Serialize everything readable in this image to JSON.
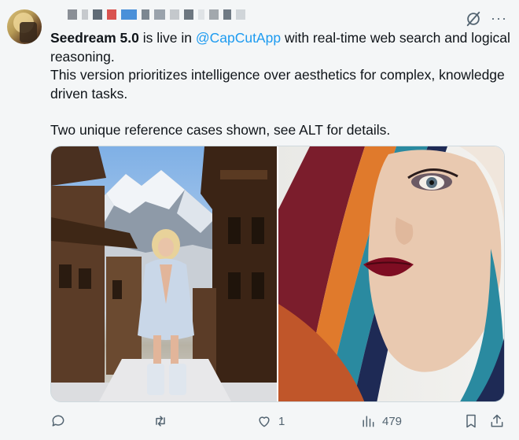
{
  "author": {
    "avatar_icon": "avatar-icon",
    "name_pixels": [
      "#8a8f96",
      "#c6c9cd",
      "#5f6b76",
      "#d9534f",
      "#4a90d9",
      "#7c8791",
      "#9aa3ac",
      "#c4c8cc",
      "#6d7780",
      "#dfe3e6",
      "#a2a8ad",
      "#6f7a84",
      "#d0d5d9"
    ]
  },
  "header_icons": {
    "grok": "grok-icon",
    "more": "more-icon",
    "more_glyph": "···"
  },
  "tweet": {
    "brand": "Seedream 5.0",
    "text_part1": " is live in ",
    "mention": "@CapCutApp",
    "text_part2": " with real-time web search and logical reasoning.",
    "line2": "This version prioritizes intelligence over aesthetics for complex, knowledge driven tasks.",
    "line3": "Two unique reference cases shown, see ALT for details."
  },
  "media": {
    "left_image": "mountain-village-woman-image",
    "right_image": "woman-headscarf-portrait-image"
  },
  "actions": {
    "reply_icon": "reply-icon",
    "retweet_icon": "retweet-icon",
    "like_icon": "heart-icon",
    "like_count": "1",
    "views_icon": "views-icon",
    "views_count": "479",
    "bookmark_icon": "bookmark-icon",
    "share_icon": "share-icon"
  },
  "colors": {
    "accent": "#1d9bf0",
    "muted": "#536471",
    "text": "#0f1419"
  }
}
